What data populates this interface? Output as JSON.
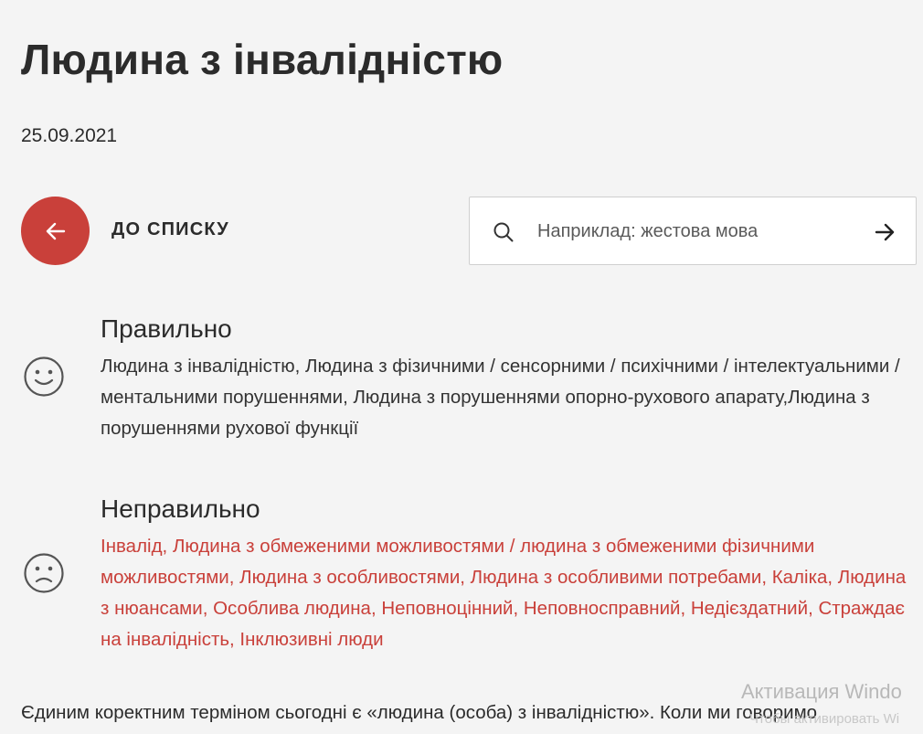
{
  "article": {
    "title": "Людина з інвалідністю",
    "date": "25.09.2021"
  },
  "navigation": {
    "back_label": "ДО СПИСКУ",
    "back_icon": "arrow-left-icon"
  },
  "search": {
    "placeholder": "Наприклад: жестова мова",
    "icon": "search-icon",
    "submit_icon": "arrow-right-icon"
  },
  "correct": {
    "heading": "Правильно",
    "icon": "smile-icon",
    "text": "Людина з інвалідністю, Людина з фізичними / сенсорними / психічними / інтелектуальними / ментальними порушеннями, Людина з порушеннями опорно-рухового апарату,Людина з порушеннями рухової функції"
  },
  "incorrect": {
    "heading": "Неправильно",
    "icon": "frown-icon",
    "text": "Інвалід, Людина з обмеженими можливостями / людина з обмеженими фізичними можливостями, Людина з особливостями, Людина з особливими потребами, Каліка, Людина з нюансами, Особлива людина, Неповноцінний, Неповносправний, Недієздатний, Страждає на інвалідність, Інклюзивні люди"
  },
  "body": {
    "paragraph_start": "Єдиним коректним терміном сьогодні є «людина (особа) з інвалідністю». Коли ми говоримо"
  },
  "watermark": {
    "line1": "Активация Windo",
    "line2": "Чтобы активировать Wi"
  },
  "colors": {
    "accent": "#c9403a",
    "background": "#f4f4f4",
    "text": "#2b2b2b"
  }
}
